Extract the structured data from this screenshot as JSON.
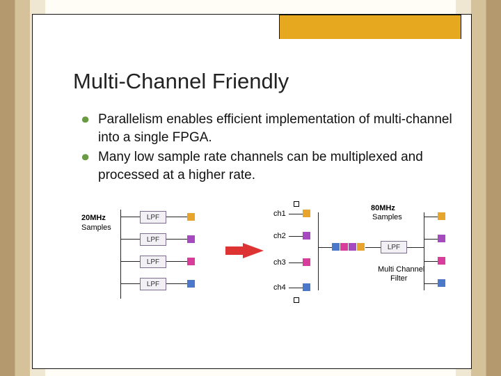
{
  "title": "Multi-Channel Friendly",
  "bullets": [
    "Parallelism enables efficient implementation of multi-channel into a single FPGA.",
    "Many low sample rate channels can be multiplexed and processed at a higher rate."
  ],
  "diagram": {
    "left_rate": "20MHz",
    "left_sub": "Samples",
    "right_rate": "80MHz",
    "right_sub": "Samples",
    "lpf": "LPF",
    "multi_line1": "Multi Channel",
    "multi_line2": "Filter",
    "ch": [
      "ch1",
      "ch2",
      "ch3",
      "ch4"
    ]
  }
}
